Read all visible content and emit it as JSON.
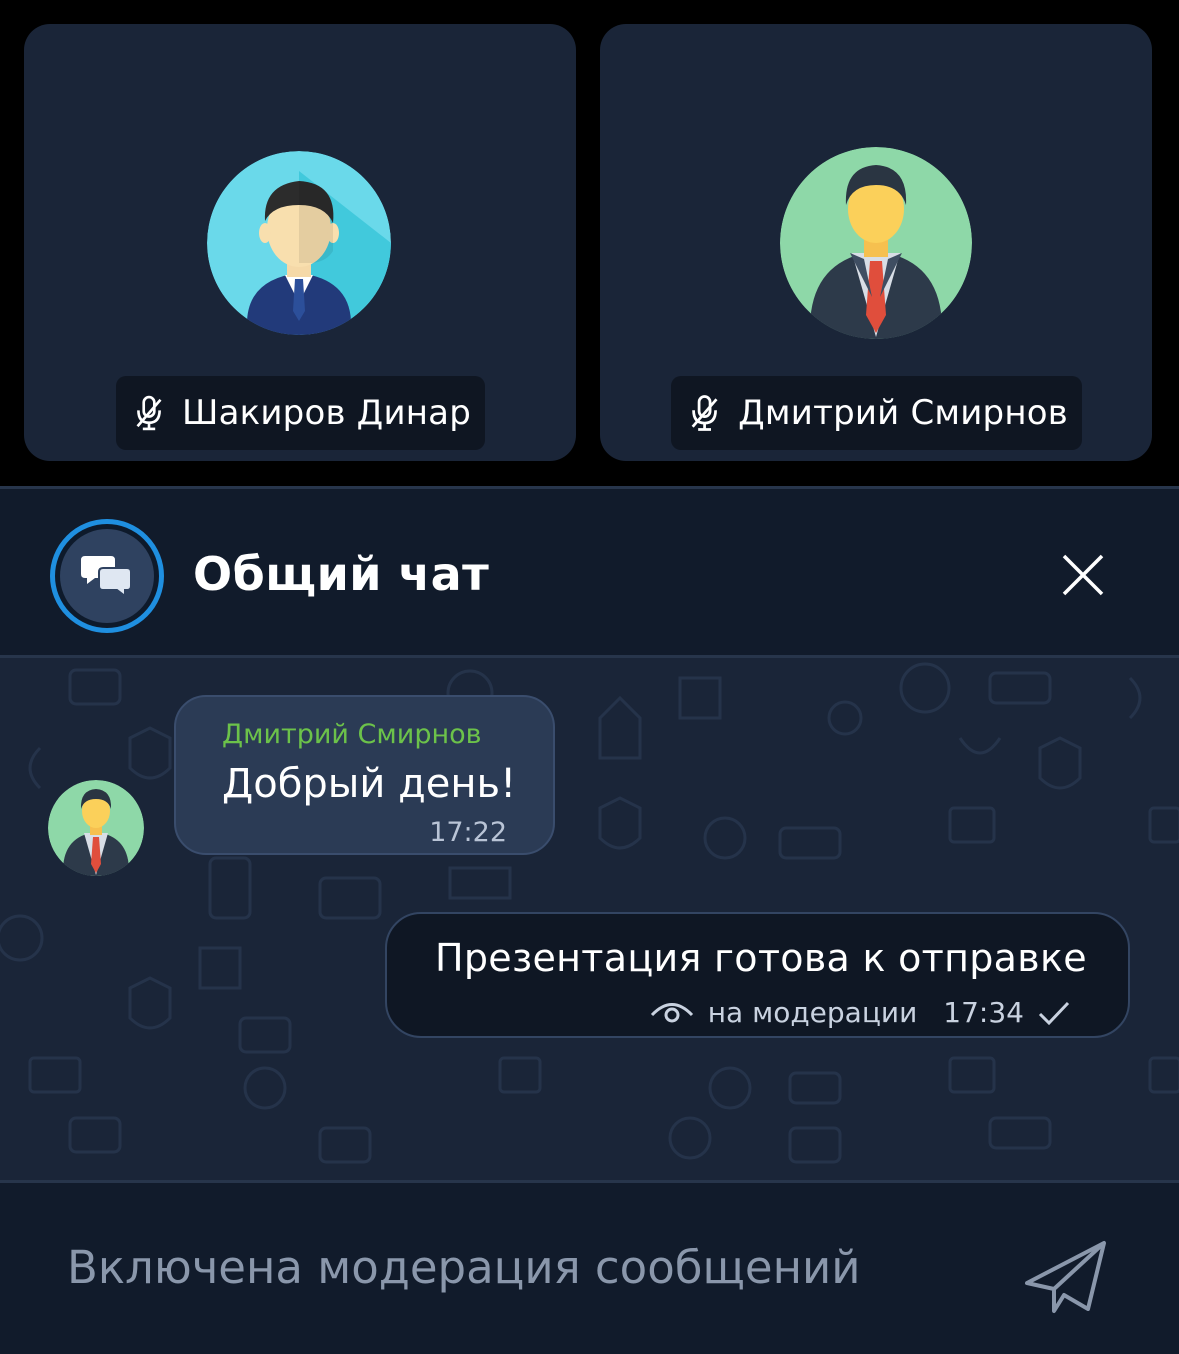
{
  "participants": [
    {
      "name": "Шакиров Динар",
      "mic_icon": "mic-muted-icon"
    },
    {
      "name": "Дмитрий Смирнов",
      "mic_icon": "mic-muted-icon"
    }
  ],
  "chat": {
    "title": "Общий чат",
    "icon": "chat-bubbles-icon",
    "close_icon": "close-icon"
  },
  "messages": [
    {
      "direction": "incoming",
      "sender": "Дмитрий Смирнов",
      "text": "Добрый день!",
      "time": "17:22"
    },
    {
      "direction": "outgoing",
      "text": "Презентация готова к отправке",
      "status": "на модерации",
      "time": "17:34",
      "status_icon": "eye-icon",
      "check_icon": "check-icon"
    }
  ],
  "input": {
    "placeholder": "Включена модерация сообщений",
    "send_icon": "send-icon"
  },
  "colors": {
    "tile_bg": "#1a2538",
    "sender_name": "#6cc24a",
    "accent_ring": "#1f8fe0",
    "placeholder": "#8a97ab"
  }
}
